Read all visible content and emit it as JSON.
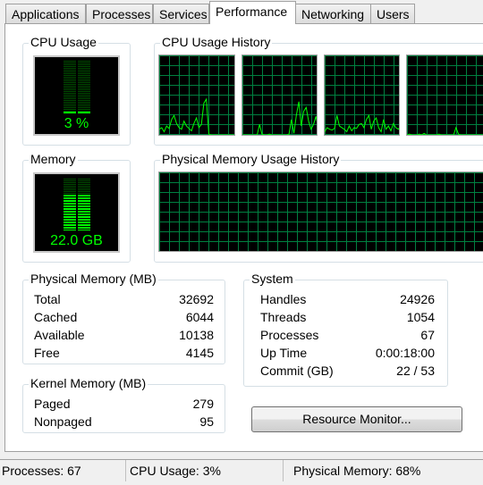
{
  "tabs": [
    {
      "label": "Applications"
    },
    {
      "label": "Processes"
    },
    {
      "label": "Services"
    },
    {
      "label": "Performance",
      "active": true
    },
    {
      "label": "Networking"
    },
    {
      "label": "Users"
    }
  ],
  "cpu_usage": {
    "title": "CPU Usage",
    "value_text": "3 %",
    "percent": 3
  },
  "cpu_history": {
    "title": "CPU Usage History",
    "cores": [
      [
        8,
        10,
        5,
        12,
        9,
        20,
        25,
        15,
        10,
        8,
        18,
        12,
        9,
        6,
        15,
        22,
        10,
        14,
        40,
        45,
        2,
        1,
        1,
        1,
        1,
        1,
        1,
        1,
        1,
        1,
        1,
        1
      ],
      [
        1,
        1,
        1,
        1,
        1,
        1,
        1,
        14,
        2,
        1,
        1,
        2,
        1,
        1,
        1,
        1,
        1,
        1,
        1,
        2,
        20,
        3,
        25,
        42,
        12,
        30,
        35,
        18,
        8,
        14,
        24,
        8
      ],
      [
        5,
        10,
        8,
        7,
        9,
        25,
        12,
        10,
        8,
        5,
        12,
        6,
        10,
        9,
        14,
        15,
        10,
        20,
        25,
        8,
        18,
        22,
        10,
        5,
        20,
        8,
        12,
        6,
        15,
        10,
        8,
        12
      ],
      [
        1,
        2,
        1,
        1,
        1,
        2,
        1,
        3,
        1,
        1,
        1,
        1,
        1,
        2,
        1,
        1,
        1,
        1,
        1,
        1,
        10,
        2,
        1,
        1,
        1,
        1,
        1,
        1,
        1,
        1,
        1,
        1
      ]
    ]
  },
  "memory": {
    "title": "Memory",
    "value_text": "22.0 GB",
    "percent": 68
  },
  "memory_history": {
    "title": "Physical Memory Usage History"
  },
  "physical_memory": {
    "title": "Physical Memory (MB)",
    "rows": [
      {
        "label": "Total",
        "value": "32692"
      },
      {
        "label": "Cached",
        "value": "6044"
      },
      {
        "label": "Available",
        "value": "10138"
      },
      {
        "label": "Free",
        "value": "4145"
      }
    ]
  },
  "kernel_memory": {
    "title": "Kernel Memory (MB)",
    "rows": [
      {
        "label": "Paged",
        "value": "279"
      },
      {
        "label": "Nonpaged",
        "value": "95"
      }
    ]
  },
  "system": {
    "title": "System",
    "rows": [
      {
        "label": "Handles",
        "value": "24926"
      },
      {
        "label": "Threads",
        "value": "1054"
      },
      {
        "label": "Processes",
        "value": "67"
      },
      {
        "label": "Up Time",
        "value": "0:00:18:00"
      },
      {
        "label": "Commit (GB)",
        "value": "22 / 53"
      }
    ]
  },
  "resource_monitor_button": "Resource Monitor...",
  "status_bar": {
    "processes": "Processes: 67",
    "cpu": "CPU Usage: 3%",
    "memory": "Physical Memory: 68%"
  },
  "colors": {
    "graph_line": "#00ff00",
    "grid": "#008040",
    "screen_bg": "#000000"
  }
}
